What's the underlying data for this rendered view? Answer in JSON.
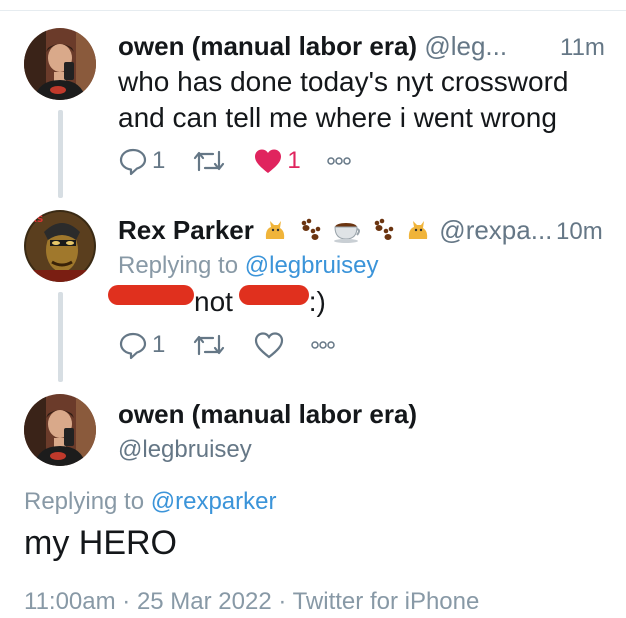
{
  "tweets": [
    {
      "name": "owen (manual labor era)",
      "handle": "@leg...",
      "time": "11m",
      "text_line1": "who has done today's nyt crossword",
      "text_line2": "and can tell me where i went wrong",
      "reply_count": "1",
      "like_count": "1"
    },
    {
      "name": "Rex Parker",
      "handle": "@rexpa...",
      "time": "10m",
      "replying_prefix": "Replying to",
      "replying_to": "@legbruisey",
      "text_mid": "not",
      "text_end": ":)",
      "reply_count": "1"
    }
  ],
  "main_tweet": {
    "name": "owen (manual labor era)",
    "handle": "@legbruisey",
    "replying_prefix": "Replying to",
    "replying_to": "@rexparker",
    "text": "my HERO",
    "meta": "11:00am · 25 Mar 2022 · Twitter for iPhone"
  },
  "icons": {
    "reply": "reply-bubble-icon",
    "retweet": "retweet-icon",
    "like": "heart-icon",
    "more": "more-dots-icon"
  },
  "colors": {
    "like_active": "#e0245e",
    "link": "#3b94d9",
    "secondary": "#657786",
    "redaction": "#e0301e"
  }
}
